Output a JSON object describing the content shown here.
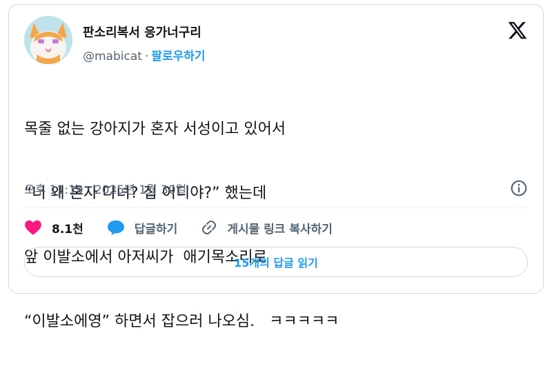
{
  "author": {
    "display_name": "판소리복서 응가너구리",
    "handle": "@mabicat",
    "separator": "·",
    "follow_label": "팔로우하기"
  },
  "tweet": {
    "lines": [
      "목줄 없는 강아지가 혼자 서성이고 있어서",
      "“너 왜 혼자 다녀? 집 어디야?” 했는데",
      "앞 이발소에서 아저씨가  애기목소리로",
      "“이발소에영” 하면서 잡으러 나오심.   ㅋㅋㅋㅋㅋ"
    ],
    "timestamp": "오후 11:19 · 2025년 1월 30일"
  },
  "actions": {
    "like_count": "8.1천",
    "reply_label": "답글하기",
    "copy_link_label": "게시물 링크 복사하기"
  },
  "replies_button": "15개의 답글 읽기",
  "colors": {
    "accent": "#1d9bf0",
    "like": "#f91880",
    "secondary_text": "#536471",
    "border": "#cfd9de"
  },
  "icons": {
    "logo": "x-logo-icon",
    "info": "info-icon",
    "like": "heart-icon",
    "reply": "speech-bubble-icon",
    "link": "link-icon"
  }
}
